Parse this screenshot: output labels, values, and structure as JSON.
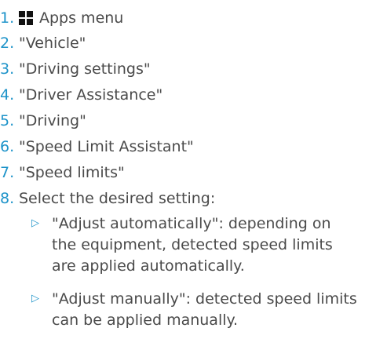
{
  "steps": [
    {
      "number": "1.",
      "text": "Apps menu",
      "icon": "apps-menu-icon"
    },
    {
      "number": "2.",
      "text": "\"Vehicle\""
    },
    {
      "number": "3.",
      "text": "\"Driving settings\""
    },
    {
      "number": "4.",
      "text": "\"Driver Assistance\""
    },
    {
      "number": "5.",
      "text": "\"Driving\""
    },
    {
      "number": "6.",
      "text": "\"Speed Limit Assistant\""
    },
    {
      "number": "7.",
      "text": "\"Speed limits\""
    },
    {
      "number": "8.",
      "text": "Select the desired setting:"
    }
  ],
  "options": [
    {
      "bullet": "▷",
      "lines": [
        "\"Adjust automatically\": depending on",
        "the equipment, detected speed limits",
        "are applied automatically."
      ]
    },
    {
      "bullet": "▷",
      "lines": [
        "\"Adjust manually\": detected speed limits",
        "can be applied manually."
      ]
    }
  ],
  "colors": {
    "number_accent": "#1d93c9",
    "text": "#4a4a4a",
    "icon": "#111111"
  }
}
